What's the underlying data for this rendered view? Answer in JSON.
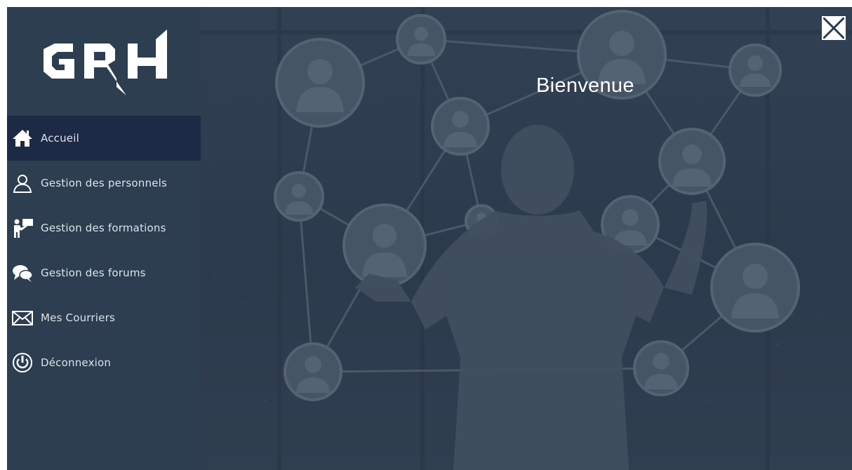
{
  "app": {
    "logo_text": "GRH",
    "welcome_title": "Bienvenue"
  },
  "sidebar": {
    "items": [
      {
        "label": "Accueil",
        "icon": "home-icon",
        "active": true
      },
      {
        "label": "Gestion des personnels",
        "icon": "user-icon",
        "active": false
      },
      {
        "label": "Gestion des formations",
        "icon": "presenter-icon",
        "active": false
      },
      {
        "label": "Gestion des forums",
        "icon": "chat-bubbles-icon",
        "active": false
      },
      {
        "label": "Mes Courriers",
        "icon": "envelope-icon",
        "active": false
      },
      {
        "label": "Déconnexion",
        "icon": "power-icon",
        "active": false
      }
    ]
  },
  "colors": {
    "sidebar_bg": "#2c3e50",
    "active_item_bg": "#1d2a45",
    "main_overlay": "#28384a",
    "text": "#ffffff"
  }
}
